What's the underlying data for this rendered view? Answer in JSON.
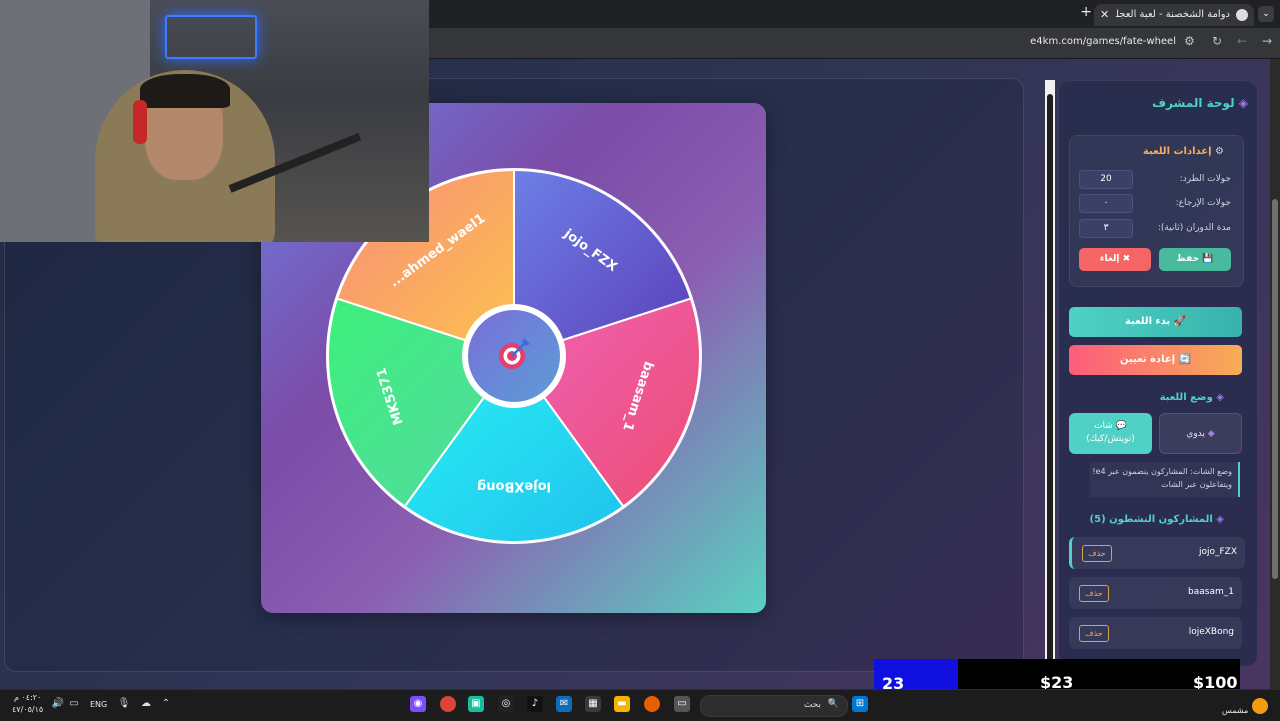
{
  "browser": {
    "tab_title": "دوامة الشخصنة - لعبة العجلة والـ",
    "url": "e4km.com/games/fate-wheel",
    "tab_close": "✕",
    "new_tab": "+"
  },
  "wheel": {
    "segments": [
      {
        "name": "jojo_FZX",
        "color": "#6b5fd8"
      },
      {
        "name": "baasam_1",
        "color": "#ee5a9b"
      },
      {
        "name": "lojeXBong",
        "color": "#2fd6ea"
      },
      {
        "name": "MK5371",
        "color": "#4be08a"
      },
      {
        "name": "...ahmed_wael1",
        "color": "#f8a268"
      }
    ],
    "center_icon": "target-icon"
  },
  "admin": {
    "title": "لوحة المشرف",
    "settings_title": "إعدادات اللعبة",
    "fields": [
      {
        "label": "جولات الطرد:",
        "value": "20"
      },
      {
        "label": "جولات الإرجاع:",
        "value": "٠"
      },
      {
        "label": "مدة الدوران (ثانية):",
        "value": "٣"
      }
    ],
    "save_label": "حفظ",
    "cancel_label": "إلغاء",
    "start_label": "بدء اللعبة",
    "reset_label": "إعادة تعيين",
    "mode_title": "وضع اللعبة",
    "mode_chat_line1": "شات",
    "mode_chat_line2": "(تويتش/كيك)",
    "mode_manual": "يدوي",
    "mode_desc": "وضع الشات: المشاركون ينضمون عبر e4! ويتفاعلون عبر الشات",
    "participants_title": "المشاركون النشطون (5)",
    "participants": [
      "jojo_FZX",
      "baasam_1",
      "lojeXBong"
    ],
    "delete_label": "حذف"
  },
  "stream_overlay": {
    "count": "23",
    "amount_mid": "$23",
    "amount_right": "$100"
  },
  "taskbar": {
    "search_placeholder": "بحث",
    "lang": "ENG",
    "time": "٠٤:٢٠ م",
    "date": "٤٧/٠٥/١٥",
    "weather": "مشمس"
  },
  "colors": {
    "accent_teal": "#4fd1c5",
    "accent_orange": "#f6ad55",
    "danger": "#f56565"
  }
}
